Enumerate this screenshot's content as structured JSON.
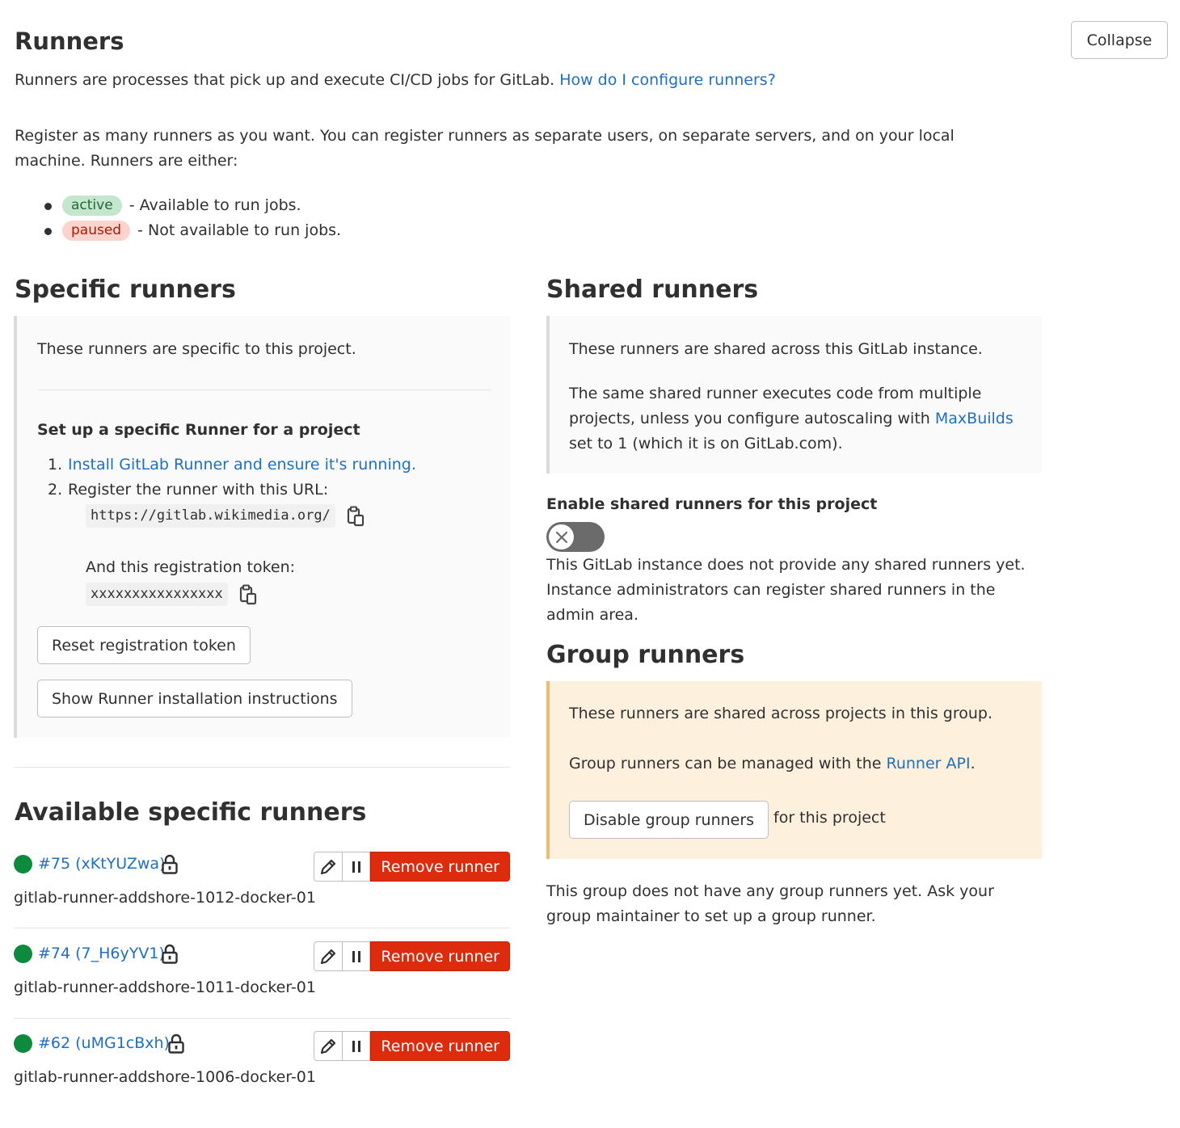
{
  "header": {
    "title": "Runners",
    "collapse_label": "Collapse",
    "intro_text": "Runners are processes that pick up and execute CI/CD jobs for GitLab.",
    "intro_link": "How do I configure runners?",
    "register_text": "Register as many runners as you want. You can register runners as separate users, on separate servers, and on your local machine. Runners are either:",
    "states": [
      {
        "badge": "active",
        "text": "- Available to run jobs."
      },
      {
        "badge": "paused",
        "text": "- Not available to run jobs."
      }
    ]
  },
  "specific": {
    "heading": "Specific runners",
    "desc": "These runners are specific to this project.",
    "setup_title": "Set up a specific Runner for a project",
    "step1_num": "1.",
    "step1_link": "Install GitLab Runner and ensure it's running.",
    "step2_num": "2.",
    "step2_text": "Register the runner with this URL:",
    "url": "https://gitlab.wikimedia.org/",
    "token_label": "And this registration token:",
    "token": "xxxxxxxxxxxxxxxx",
    "reset_label": "Reset registration token",
    "show_instructions_label": "Show Runner installation instructions"
  },
  "available": {
    "heading": "Available specific runners",
    "remove_label": "Remove runner",
    "runners": [
      {
        "id": "#75 (xKtYUZwa)",
        "description": "gitlab-runner-addshore-1012-docker-01"
      },
      {
        "id": "#74 (7_H6yYV1)",
        "description": "gitlab-runner-addshore-1011-docker-01"
      },
      {
        "id": "#62 (uMG1cBxh)",
        "description": "gitlab-runner-addshore-1006-docker-01"
      }
    ]
  },
  "shared": {
    "heading": "Shared runners",
    "desc1": "These runners are shared across this GitLab instance.",
    "desc2_before": "The same shared runner executes code from multiple projects, unless you configure autoscaling with",
    "desc2_link": "MaxBuilds",
    "desc2_after": "set to 1 (which it is on GitLab.com).",
    "enable_label": "Enable shared runners for this project",
    "none_text": "This GitLab instance does not provide any shared runners yet. Instance administrators can register shared runners in the admin area."
  },
  "group": {
    "heading": "Group runners",
    "desc1": "These runners are shared across projects in this group.",
    "desc2_before": "Group runners can be managed with the",
    "desc2_link": "Runner API",
    "desc2_after": ".",
    "disable_label": "Disable group runners",
    "disable_suffix": "for this project",
    "none_text": "This group does not have any group runners yet. Ask your group maintainer to set up a group runner."
  },
  "colors": {
    "link": "#1f6fc2",
    "danger": "#dd2b0e",
    "online": "#0e8a3e"
  }
}
